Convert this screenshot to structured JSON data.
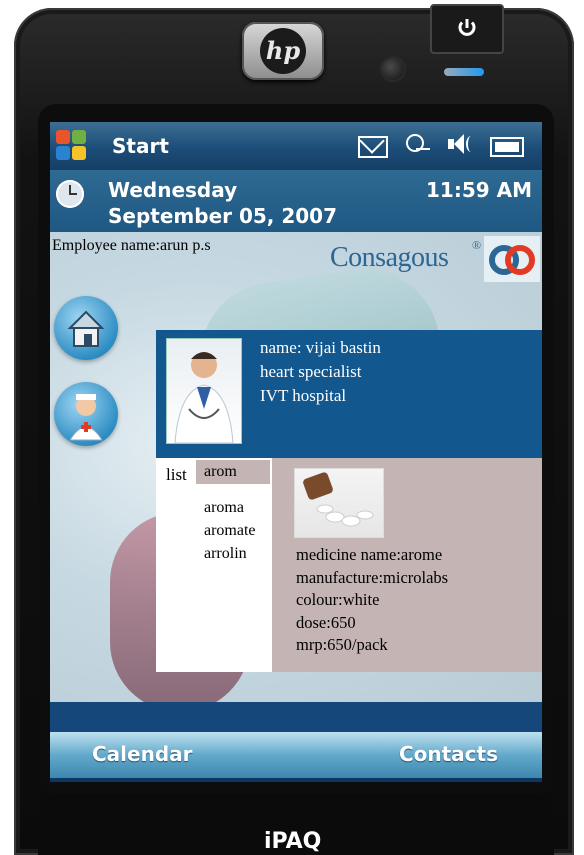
{
  "device": {
    "brand_logo": "hp",
    "model": "iPAQ",
    "power_icon": "power-icon"
  },
  "topbar": {
    "start_label": "Start",
    "icons": [
      "mail-icon",
      "connectivity-icon",
      "volume-icon",
      "battery-icon"
    ]
  },
  "datebar": {
    "day": "Wednesday",
    "date": "September 05, 2007",
    "time": "11:59 AM"
  },
  "header": {
    "employee_label": "Employee name:arun p.s",
    "brand_name": "Consagous",
    "brand_reg": "®"
  },
  "doctor": {
    "name": "name: vijai bastin",
    "specialty": "heart specialist",
    "hospital": "IVT hospital"
  },
  "list": {
    "label": "list",
    "search_value": "arom",
    "items": [
      "aroma",
      "aromate",
      "arrolin"
    ]
  },
  "medicine": {
    "name": "medicine name:arome",
    "manufacture": "manufacture:microlabs",
    "colour": "colour:white",
    "dose": "dose:650",
    "mrp": "mrp:650/pack"
  },
  "softkeys": {
    "left": "Calendar",
    "right": "Contacts"
  },
  "colors": {
    "panel_blue": "#12578e",
    "medicine_bg": "#c5b4b4",
    "brand_blue": "#2c6694"
  }
}
